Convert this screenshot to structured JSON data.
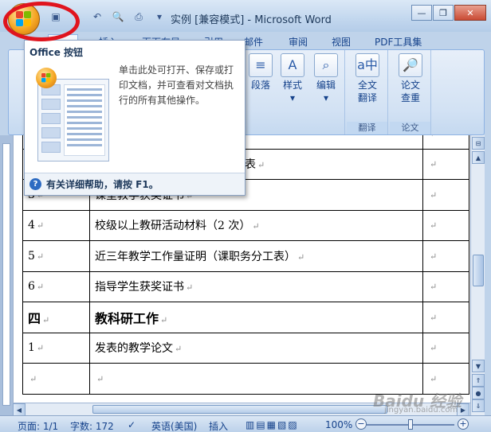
{
  "window": {
    "title": "实例 [兼容模式] - Microsoft Word",
    "controls": [
      "minimize",
      "restore",
      "close"
    ]
  },
  "qat": {
    "save_icon": "save-icon",
    "undo_icon": "undo-icon",
    "print_preview_icon": "print-preview-icon",
    "print_icon": "print-icon",
    "customize_icon": "chevron-down-icon"
  },
  "tabs": [
    {
      "label": "开始"
    },
    {
      "label": "插入"
    },
    {
      "label": "页面布局"
    },
    {
      "label": "引用"
    },
    {
      "label": "邮件"
    },
    {
      "label": "审阅"
    },
    {
      "label": "视图"
    },
    {
      "label": "PDF工具集"
    }
  ],
  "ribbon": {
    "paragraph_label": "段落",
    "styles_label": "样式",
    "edit_label": "编辑",
    "fulltext_translate_label": "全文\n翻译",
    "paper_lookup_label": "论文\n查重",
    "group_translate": "翻译",
    "group_paper": "论文"
  },
  "office_menu": {
    "title": "Office 按钮",
    "description": "单击此处可打开、保存或打印文档，并可查看对文档执行的所有其他操作。",
    "help": "有关详细帮助，请按 F1。"
  },
  "table": {
    "rows": [
      {
        "num": "",
        "text": "",
        "mark": "↵"
      },
      {
        "num": "",
        "text": "总表",
        "mark": "↵"
      },
      {
        "num": "3",
        "text": "课堂教学获奖证书",
        "mark": "↵"
      },
      {
        "num": "4",
        "text": "校级以上教研活动材料（2 次）",
        "mark": "↵"
      },
      {
        "num": "5",
        "text": "近三年教学工作量证明（课职务分工表）",
        "mark": "↵"
      },
      {
        "num": "6",
        "text": "指导学生获奖证书",
        "mark": "↵"
      },
      {
        "num": "四",
        "text": "教科研工作",
        "mark": "↵"
      },
      {
        "num": "1",
        "text": "发表的教学论文",
        "mark": "↵"
      },
      {
        "num": "",
        "text": "",
        "mark": "↵"
      }
    ]
  },
  "statusbar": {
    "page": "页面: 1/1",
    "words": "字数: 172",
    "language": "英语(美国)",
    "insert": "插入",
    "zoom": "100%",
    "zoom_level": 1.0
  },
  "watermark": {
    "text": "Baidu 经验",
    "url": "jingyan.baidu.com"
  }
}
